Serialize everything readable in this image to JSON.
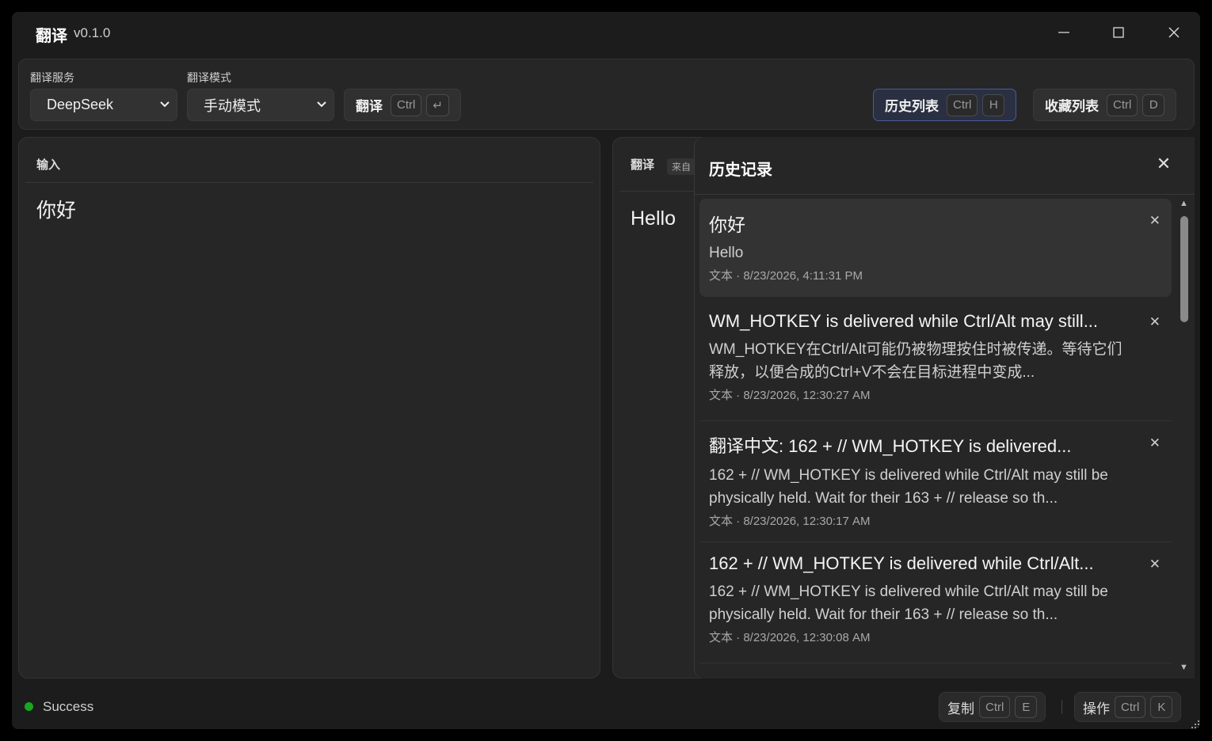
{
  "app": {
    "title": "翻译",
    "version": "v0.1.0"
  },
  "window_controls": {
    "minimize": "—",
    "maximize": "☐",
    "close": "✕"
  },
  "toolbar": {
    "service_label": "翻译服务",
    "service_value": "DeepSeek",
    "mode_label": "翻译模式",
    "mode_value": "手动模式",
    "translate": {
      "label": "翻译",
      "key1": "Ctrl",
      "key2": "↵"
    },
    "history": {
      "label": "历史列表",
      "key1": "Ctrl",
      "key2": "H"
    },
    "favorites": {
      "label": "收藏列表",
      "key1": "Ctrl",
      "key2": "D"
    }
  },
  "input_panel": {
    "header": "输入",
    "text": "你好"
  },
  "output_panel": {
    "header": "翻译",
    "source_badge": "来自",
    "text": "Hello"
  },
  "history": {
    "title": "历史记录",
    "close": "✕",
    "items": [
      {
        "source": "你好",
        "translation": "Hello",
        "meta": "文本 · 8/23/2026, 4:11:31 PM",
        "delete": "✕"
      },
      {
        "source": "WM_HOTKEY is delivered while Ctrl/Alt may still...",
        "translation": "WM_HOTKEY在Ctrl/Alt可能仍被物理按住时被传递。等待它们释放，以便合成的Ctrl+V不会在目标进程中变成...",
        "meta": "文本 · 8/23/2026, 12:30:27 AM",
        "delete": "✕"
      },
      {
        "source": "翻译中文: 162 + // WM_HOTKEY is delivered...",
        "translation": "162 + // WM_HOTKEY is delivered while Ctrl/Alt may still be physically held. Wait for their 163 + // release so th...",
        "meta": "文本 · 8/23/2026, 12:30:17 AM",
        "delete": "✕"
      },
      {
        "source": "162 + // WM_HOTKEY is delivered while Ctrl/Alt...",
        "translation": "162 + // WM_HOTKEY is delivered while Ctrl/Alt may still be physically held. Wait for their 163 + // release so th...",
        "meta": "文本 · 8/23/2026, 12:30:08 AM",
        "delete": "✕"
      }
    ]
  },
  "statusbar": {
    "status": "Success",
    "status_color": "#17a71f",
    "copy": {
      "label": "复制",
      "key1": "Ctrl",
      "key2": "E"
    },
    "action": {
      "label": "操作",
      "key1": "Ctrl",
      "key2": "K"
    }
  }
}
